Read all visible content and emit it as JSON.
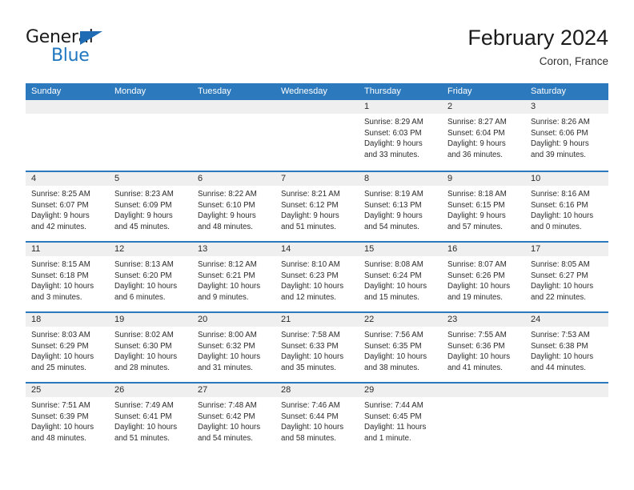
{
  "brand": {
    "name_part1": "General",
    "name_part2": "Blue",
    "triangle_color": "#1f6cb4",
    "blue_color": "#2077c0"
  },
  "header": {
    "title": "February 2024",
    "subtitle": "Coron, France"
  },
  "theme": {
    "header_blue": "#2c79bd",
    "day_band_gray": "#efefef",
    "text_color": "#2b2b2b"
  },
  "weekdays": [
    "Sunday",
    "Monday",
    "Tuesday",
    "Wednesday",
    "Thursday",
    "Friday",
    "Saturday"
  ],
  "weeks": [
    [
      {
        "day": "",
        "lines": []
      },
      {
        "day": "",
        "lines": []
      },
      {
        "day": "",
        "lines": []
      },
      {
        "day": "",
        "lines": []
      },
      {
        "day": "1",
        "lines": [
          "Sunrise: 8:29 AM",
          "Sunset: 6:03 PM",
          "Daylight: 9 hours",
          "and 33 minutes."
        ]
      },
      {
        "day": "2",
        "lines": [
          "Sunrise: 8:27 AM",
          "Sunset: 6:04 PM",
          "Daylight: 9 hours",
          "and 36 minutes."
        ]
      },
      {
        "day": "3",
        "lines": [
          "Sunrise: 8:26 AM",
          "Sunset: 6:06 PM",
          "Daylight: 9 hours",
          "and 39 minutes."
        ]
      }
    ],
    [
      {
        "day": "4",
        "lines": [
          "Sunrise: 8:25 AM",
          "Sunset: 6:07 PM",
          "Daylight: 9 hours",
          "and 42 minutes."
        ]
      },
      {
        "day": "5",
        "lines": [
          "Sunrise: 8:23 AM",
          "Sunset: 6:09 PM",
          "Daylight: 9 hours",
          "and 45 minutes."
        ]
      },
      {
        "day": "6",
        "lines": [
          "Sunrise: 8:22 AM",
          "Sunset: 6:10 PM",
          "Daylight: 9 hours",
          "and 48 minutes."
        ]
      },
      {
        "day": "7",
        "lines": [
          "Sunrise: 8:21 AM",
          "Sunset: 6:12 PM",
          "Daylight: 9 hours",
          "and 51 minutes."
        ]
      },
      {
        "day": "8",
        "lines": [
          "Sunrise: 8:19 AM",
          "Sunset: 6:13 PM",
          "Daylight: 9 hours",
          "and 54 minutes."
        ]
      },
      {
        "day": "9",
        "lines": [
          "Sunrise: 8:18 AM",
          "Sunset: 6:15 PM",
          "Daylight: 9 hours",
          "and 57 minutes."
        ]
      },
      {
        "day": "10",
        "lines": [
          "Sunrise: 8:16 AM",
          "Sunset: 6:16 PM",
          "Daylight: 10 hours",
          "and 0 minutes."
        ]
      }
    ],
    [
      {
        "day": "11",
        "lines": [
          "Sunrise: 8:15 AM",
          "Sunset: 6:18 PM",
          "Daylight: 10 hours",
          "and 3 minutes."
        ]
      },
      {
        "day": "12",
        "lines": [
          "Sunrise: 8:13 AM",
          "Sunset: 6:20 PM",
          "Daylight: 10 hours",
          "and 6 minutes."
        ]
      },
      {
        "day": "13",
        "lines": [
          "Sunrise: 8:12 AM",
          "Sunset: 6:21 PM",
          "Daylight: 10 hours",
          "and 9 minutes."
        ]
      },
      {
        "day": "14",
        "lines": [
          "Sunrise: 8:10 AM",
          "Sunset: 6:23 PM",
          "Daylight: 10 hours",
          "and 12 minutes."
        ]
      },
      {
        "day": "15",
        "lines": [
          "Sunrise: 8:08 AM",
          "Sunset: 6:24 PM",
          "Daylight: 10 hours",
          "and 15 minutes."
        ]
      },
      {
        "day": "16",
        "lines": [
          "Sunrise: 8:07 AM",
          "Sunset: 6:26 PM",
          "Daylight: 10 hours",
          "and 19 minutes."
        ]
      },
      {
        "day": "17",
        "lines": [
          "Sunrise: 8:05 AM",
          "Sunset: 6:27 PM",
          "Daylight: 10 hours",
          "and 22 minutes."
        ]
      }
    ],
    [
      {
        "day": "18",
        "lines": [
          "Sunrise: 8:03 AM",
          "Sunset: 6:29 PM",
          "Daylight: 10 hours",
          "and 25 minutes."
        ]
      },
      {
        "day": "19",
        "lines": [
          "Sunrise: 8:02 AM",
          "Sunset: 6:30 PM",
          "Daylight: 10 hours",
          "and 28 minutes."
        ]
      },
      {
        "day": "20",
        "lines": [
          "Sunrise: 8:00 AM",
          "Sunset: 6:32 PM",
          "Daylight: 10 hours",
          "and 31 minutes."
        ]
      },
      {
        "day": "21",
        "lines": [
          "Sunrise: 7:58 AM",
          "Sunset: 6:33 PM",
          "Daylight: 10 hours",
          "and 35 minutes."
        ]
      },
      {
        "day": "22",
        "lines": [
          "Sunrise: 7:56 AM",
          "Sunset: 6:35 PM",
          "Daylight: 10 hours",
          "and 38 minutes."
        ]
      },
      {
        "day": "23",
        "lines": [
          "Sunrise: 7:55 AM",
          "Sunset: 6:36 PM",
          "Daylight: 10 hours",
          "and 41 minutes."
        ]
      },
      {
        "day": "24",
        "lines": [
          "Sunrise: 7:53 AM",
          "Sunset: 6:38 PM",
          "Daylight: 10 hours",
          "and 44 minutes."
        ]
      }
    ],
    [
      {
        "day": "25",
        "lines": [
          "Sunrise: 7:51 AM",
          "Sunset: 6:39 PM",
          "Daylight: 10 hours",
          "and 48 minutes."
        ]
      },
      {
        "day": "26",
        "lines": [
          "Sunrise: 7:49 AM",
          "Sunset: 6:41 PM",
          "Daylight: 10 hours",
          "and 51 minutes."
        ]
      },
      {
        "day": "27",
        "lines": [
          "Sunrise: 7:48 AM",
          "Sunset: 6:42 PM",
          "Daylight: 10 hours",
          "and 54 minutes."
        ]
      },
      {
        "day": "28",
        "lines": [
          "Sunrise: 7:46 AM",
          "Sunset: 6:44 PM",
          "Daylight: 10 hours",
          "and 58 minutes."
        ]
      },
      {
        "day": "29",
        "lines": [
          "Sunrise: 7:44 AM",
          "Sunset: 6:45 PM",
          "Daylight: 11 hours",
          "and 1 minute."
        ]
      },
      {
        "day": "",
        "lines": []
      },
      {
        "day": "",
        "lines": []
      }
    ]
  ]
}
